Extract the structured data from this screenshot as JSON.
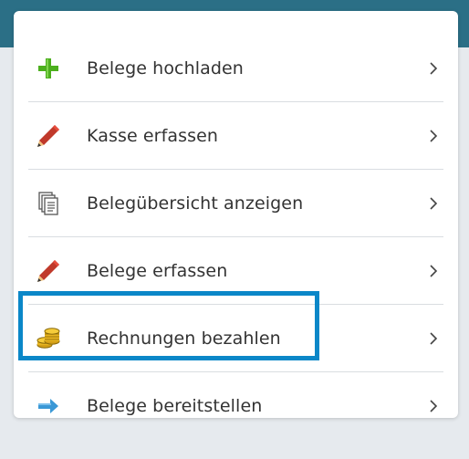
{
  "menu": {
    "items": [
      {
        "label": "Belege hochladen",
        "icon": "plus-icon"
      },
      {
        "label": "Kasse erfassen",
        "icon": "pencil-icon"
      },
      {
        "label": "Belegübersicht anzeigen",
        "icon": "documents-icon"
      },
      {
        "label": "Belege erfassen",
        "icon": "pencil-icon"
      },
      {
        "label": "Rechnungen bezahlen",
        "icon": "coins-icon"
      },
      {
        "label": "Belege bereitstellen",
        "icon": "arrow-right-icon"
      }
    ],
    "highlighted_item": "Rechnungen bezahlen"
  },
  "colors": {
    "header_band": "#2b6f86",
    "background": "#e6eaee",
    "highlight_border": "#0b87c8",
    "plus_green": "#4caf1e",
    "pencil_red": "#c0392b",
    "arrow_blue": "#3a98d6",
    "coin_gold": "#e8b520"
  }
}
